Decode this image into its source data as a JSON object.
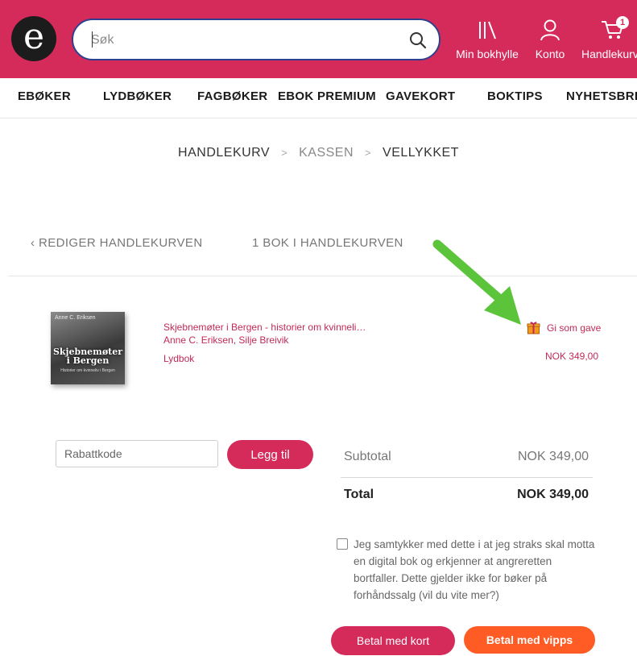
{
  "header": {
    "logo_letter": "e",
    "search": {
      "placeholder": "Søk"
    },
    "items": [
      {
        "label": "Min bokhylle",
        "icon": "bookshelf-icon"
      },
      {
        "label": "Konto",
        "icon": "user-icon"
      },
      {
        "label": "Handlekurv",
        "icon": "cart-icon",
        "badge": "1"
      }
    ]
  },
  "nav": [
    "EBØKER",
    "LYDBØKER",
    "FAGBØKER",
    "EBOK PREMIUM",
    "GAVEKORT",
    "BOKTIPS",
    "NYHETSBREV"
  ],
  "breadcrumb": {
    "step1": "HANDLEKURV",
    "step2": "KASSEN",
    "step3": "VELLYKKET",
    "separator": ">"
  },
  "cart": {
    "back_label": "‹ REDIGER HANDLEKURVEN",
    "count_label": "1 BOK I HANDLEKURVEN",
    "item": {
      "title": "Skjebnemøter i Bergen - historier om kvinneli…",
      "authors": "Anne C. Eriksen, Silje Breivik",
      "format": "Lydbok",
      "gift_label": "Gi som gave",
      "price": "NOK 349,00",
      "cover": {
        "author": "Anne C. Eriksen",
        "title_line1": "Skjebnemøter",
        "title_line2": "i Bergen",
        "subtitle": "Historier om kvinneliv i Bergen"
      }
    }
  },
  "discount": {
    "placeholder": "Rabattkode",
    "button": "Legg til"
  },
  "totals": {
    "subtotal_label": "Subtotal",
    "subtotal_value": "NOK 349,00",
    "total_label": "Total",
    "total_value": "NOK 349,00"
  },
  "consent": {
    "text": "Jeg samtykker med dette i at jeg straks skal motta en digital bok og erkjenner at angreretten bortfaller. Dette gjelder ikke for bøker på forhåndssalg (vil du vite mer?)"
  },
  "pay": {
    "card_label": "Betal med kort",
    "vipps_label": "Betal med vipps"
  },
  "colors": {
    "brand": "#d42b5a",
    "vipps": "#ff5b24",
    "arrow": "#5cc43a"
  }
}
